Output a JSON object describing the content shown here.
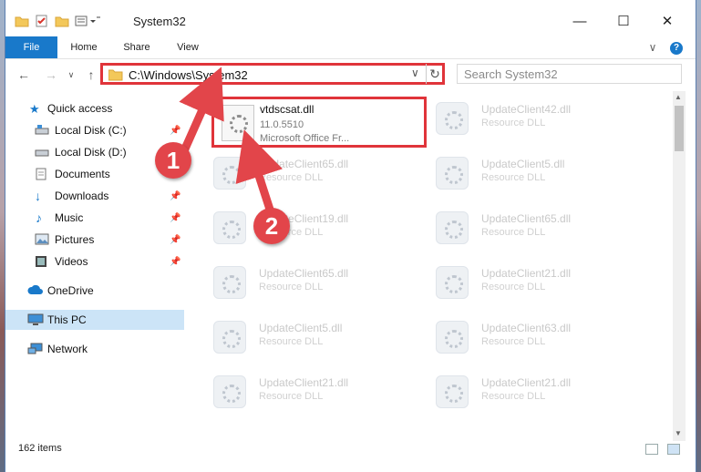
{
  "window": {
    "title": "System32"
  },
  "ribbon": {
    "tabs": [
      "File",
      "Home",
      "Share",
      "View"
    ]
  },
  "address": {
    "path": "C:\\Windows\\System32",
    "search_placeholder": "Search System32"
  },
  "nav": {
    "items": [
      {
        "label": "Quick access",
        "icon": "star-icon",
        "pinned": false
      },
      {
        "label": "Local Disk (C:)",
        "icon": "drive-icon",
        "pinned": true
      },
      {
        "label": "Local Disk (D:)",
        "icon": "drive-icon",
        "pinned": false
      },
      {
        "label": "Documents",
        "icon": "documents-icon",
        "pinned": false
      },
      {
        "label": "Downloads",
        "icon": "download-icon",
        "pinned": true
      },
      {
        "label": "Music",
        "icon": "music-icon",
        "pinned": true
      },
      {
        "label": "Pictures",
        "icon": "pictures-icon",
        "pinned": true
      },
      {
        "label": "Videos",
        "icon": "videos-icon",
        "pinned": true
      },
      {
        "label": "OneDrive",
        "icon": "cloud-icon",
        "pinned": false
      },
      {
        "label": "This PC",
        "icon": "computer-icon",
        "pinned": false
      },
      {
        "label": "Network",
        "icon": "network-icon",
        "pinned": false
      }
    ]
  },
  "highlighted_file": {
    "name": "vtdscsat.dll",
    "version": "11.0.5510",
    "description": "Microsoft Office Fr..."
  },
  "files": [
    {
      "name": "UpdateClient42.dll",
      "type": "Resource DLL"
    },
    {
      "name": "UpdateClient65.dll",
      "type": "Resource DLL"
    },
    {
      "name": "UpdateClient5.dll",
      "type": "Resource DLL"
    },
    {
      "name": "UpdateClient19.dll",
      "type": "Resource DLL"
    },
    {
      "name": "UpdateClient65.dll",
      "type": "Resource DLL"
    },
    {
      "name": "UpdateClient65.dll",
      "type": "Resource DLL"
    },
    {
      "name": "UpdateClient21.dll",
      "type": "Resource DLL"
    },
    {
      "name": "UpdateClient5.dll",
      "type": "Resource DLL"
    },
    {
      "name": "UpdateClient63.dll",
      "type": "Resource DLL"
    },
    {
      "name": "UpdateClient21.dll",
      "type": "Resource DLL"
    },
    {
      "name": "UpdateClient21.dll",
      "type": "Resource DLL"
    }
  ],
  "status": {
    "items_count": "162 items"
  },
  "annotations": {
    "step1": "1",
    "step2": "2",
    "color": "#e2454a"
  }
}
